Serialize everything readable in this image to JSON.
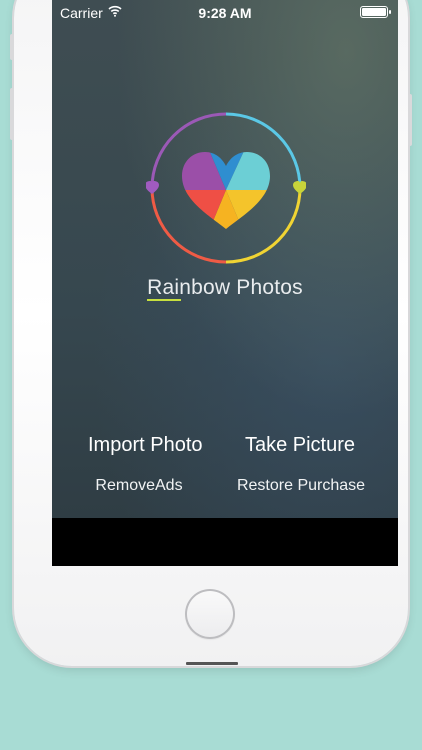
{
  "status_bar": {
    "carrier": "Carrier",
    "time": "9:28 AM",
    "wifi_icon": "wifi-icon",
    "battery_icon": "battery-icon"
  },
  "app": {
    "title": "Rainbow Photos",
    "logo_icon": "rainbow-heart-logo",
    "accent_color": "#c7df3f"
  },
  "actions": {
    "import_photo": "Import Photo",
    "take_picture": "Take Picture",
    "remove_ads": "RemoveAds",
    "restore_purchase": "Restore Purchase"
  },
  "device": {
    "home_button_icon": "home-button"
  }
}
